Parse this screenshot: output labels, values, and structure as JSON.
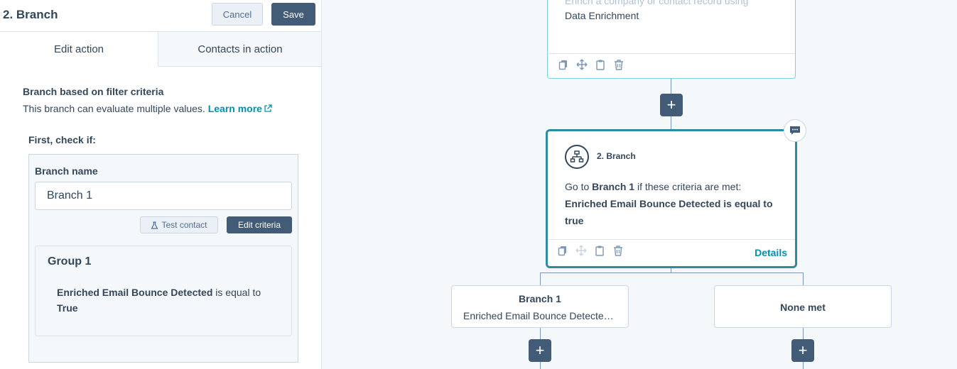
{
  "panel": {
    "title": "2. Branch",
    "cancel_label": "Cancel",
    "save_label": "Save",
    "tabs": [
      {
        "label": "Edit action",
        "active": true
      },
      {
        "label": "Contacts in action",
        "active": false
      }
    ],
    "section_title": "Branch based on filter criteria",
    "section_desc": "This branch can evaluate multiple values.",
    "learn_more": "Learn more",
    "first_check": "First, check if:",
    "branch_name_label": "Branch name",
    "branch_name_value": "Branch 1",
    "test_contact_label": "Test contact",
    "edit_criteria_label": "Edit criteria",
    "group": {
      "title": "Group 1",
      "property": "Enriched Email Bounce Detected",
      "operator": " is equal to ",
      "value": "True"
    }
  },
  "canvas": {
    "prev_action": {
      "faded_text": "Enrich a company or contact record using",
      "text": "Data Enrichment"
    },
    "branch_action": {
      "title": "2. Branch",
      "go_to": "Go to ",
      "branch": "Branch 1",
      "criteria_met": " if these criteria are met:",
      "criteria": "Enriched Email Bounce Detected is equal to true",
      "details": "Details"
    },
    "branches": [
      {
        "title": "Branch 1",
        "subtitle": "Enriched Email Bounce Detected is equal to true"
      },
      {
        "title": "None met"
      }
    ]
  },
  "colors": {
    "primary": "#425b76",
    "link": "#0091ae",
    "selected_border": "#2e8ba1",
    "connector": "#7c98b6"
  }
}
